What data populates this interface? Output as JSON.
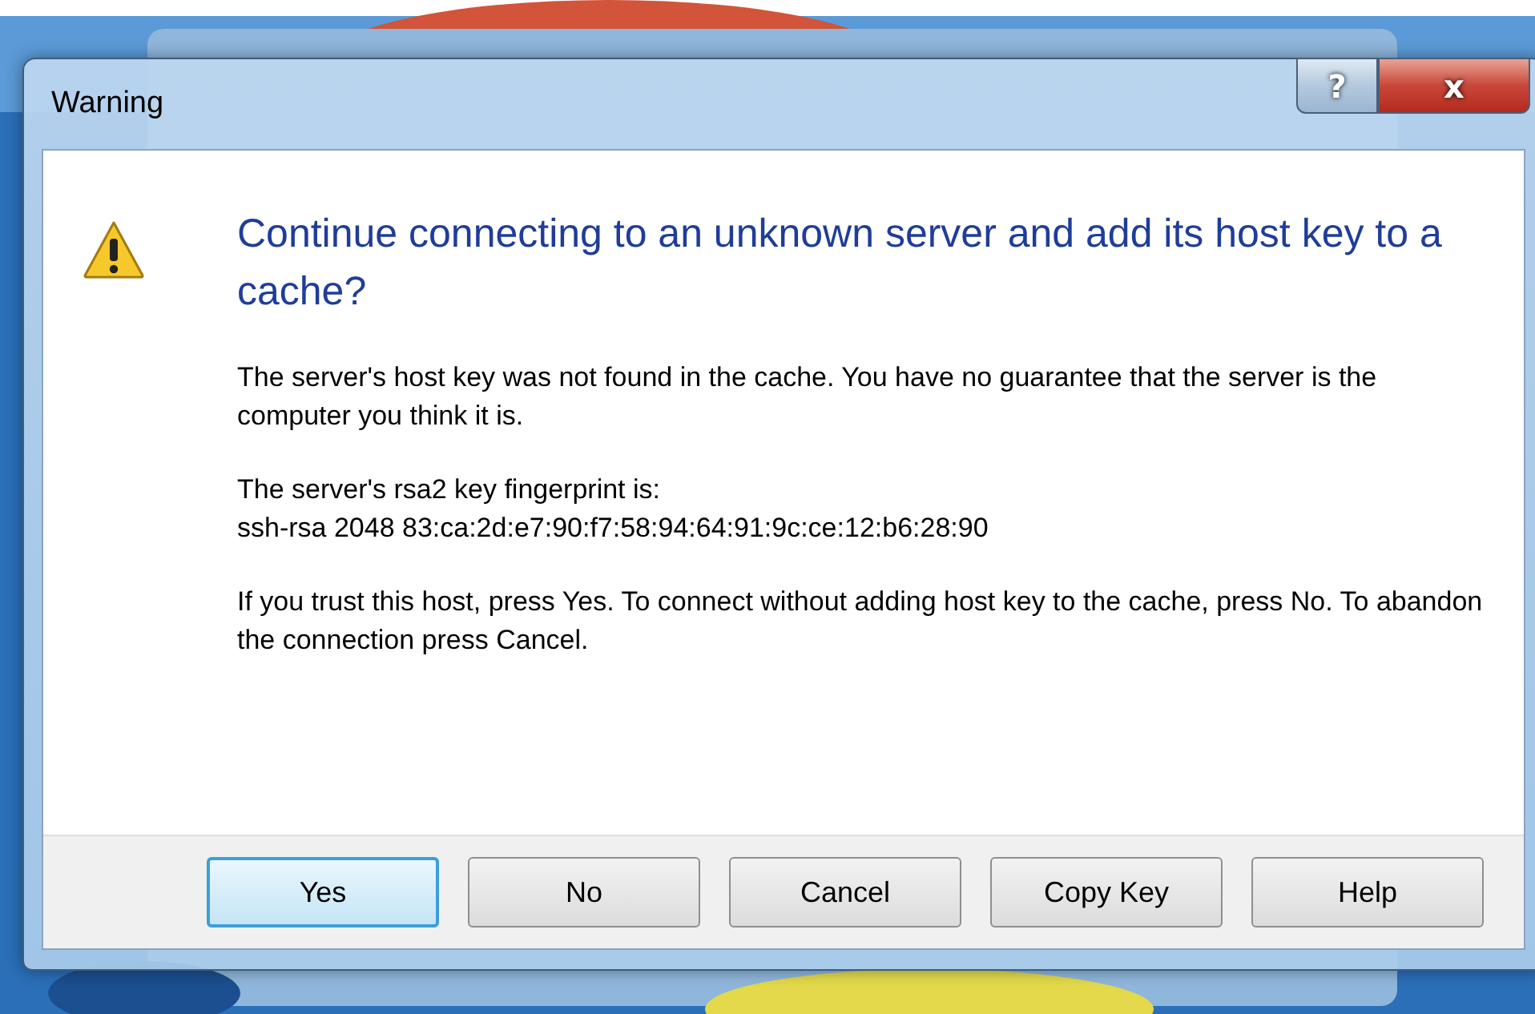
{
  "window": {
    "title": "Warning",
    "help_button": "?",
    "close_button": "x"
  },
  "heading": "Continue connecting to an unknown server and add its host key to a cache?",
  "paragraphs": [
    [
      "The server's host key was not found in the cache. You have no guarantee that the server is the computer you think it is."
    ],
    [
      "The server's rsa2 key fingerprint is:",
      "ssh-rsa 2048 83:ca:2d:e7:90:f7:58:94:64:91:9c:ce:12:b6:28:90"
    ],
    [
      "If you trust this host, press Yes. To connect without adding host key to the cache, press No. To abandon the connection press Cancel."
    ]
  ],
  "buttons": [
    {
      "label": "Yes",
      "default": true
    },
    {
      "label": "No",
      "default": false
    },
    {
      "label": "Cancel",
      "default": false
    },
    {
      "label": "Copy Key",
      "default": false
    },
    {
      "label": "Help",
      "default": false
    }
  ]
}
